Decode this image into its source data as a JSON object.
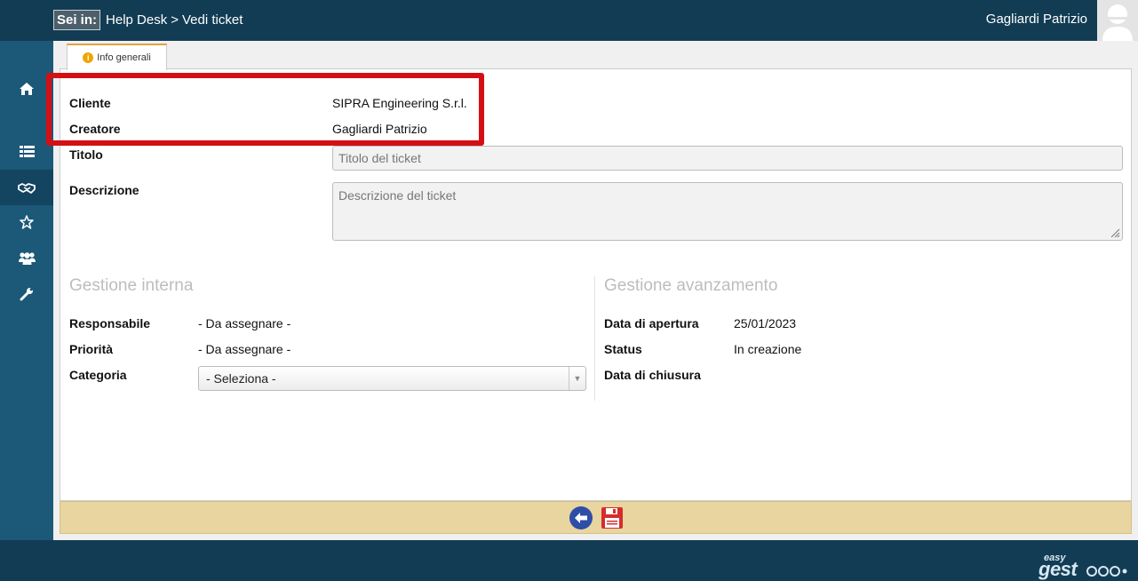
{
  "header": {
    "breadcrumb_prefix": "Sei in:",
    "breadcrumb_section": "Help Desk",
    "breadcrumb_separator": ">",
    "breadcrumb_page": "Vedi ticket",
    "user_name": "Gagliardi Patrizio"
  },
  "sidebar": {
    "items": [
      {
        "icon": "home-icon"
      },
      {
        "icon": "list-icon"
      },
      {
        "icon": "handshake-icon",
        "active": true
      },
      {
        "icon": "star-icon"
      },
      {
        "icon": "users-icon"
      },
      {
        "icon": "wrench-icon"
      }
    ]
  },
  "tabs": [
    {
      "label": "Info generali",
      "icon": "info-icon"
    }
  ],
  "form": {
    "cliente_label": "Cliente",
    "cliente_value": "SIPRA Engineering S.r.l.",
    "creatore_label": "Creatore",
    "creatore_value": "Gagliardi Patrizio",
    "titolo_label": "Titolo",
    "titolo_placeholder": "Titolo del ticket",
    "descrizione_label": "Descrizione",
    "descrizione_placeholder": "Descrizione del ticket"
  },
  "gestione_interna": {
    "title": "Gestione interna",
    "responsabile_label": "Responsabile",
    "responsabile_value": "- Da assegnare -",
    "priorita_label": "Priorità",
    "priorita_value": "- Da assegnare -",
    "categoria_label": "Categoria",
    "categoria_selected": "- Seleziona -"
  },
  "gestione_avanzamento": {
    "title": "Gestione avanzamento",
    "apertura_label": "Data di apertura",
    "apertura_value": "25/01/2023",
    "status_label": "Status",
    "status_value": "In creazione",
    "chiusura_label": "Data di chiusura",
    "chiusura_value": ""
  },
  "footer_actions": [
    {
      "icon": "back-arrow-icon"
    },
    {
      "icon": "save-icon"
    }
  ],
  "branding": {
    "logo_small": "easy",
    "logo_main": "gest"
  },
  "colors": {
    "topbar": "#123c54",
    "sidebar": "#1c5878",
    "highlight": "#d40f14",
    "action_bar": "#e8d59f",
    "tab_accent": "#e1a33b"
  }
}
